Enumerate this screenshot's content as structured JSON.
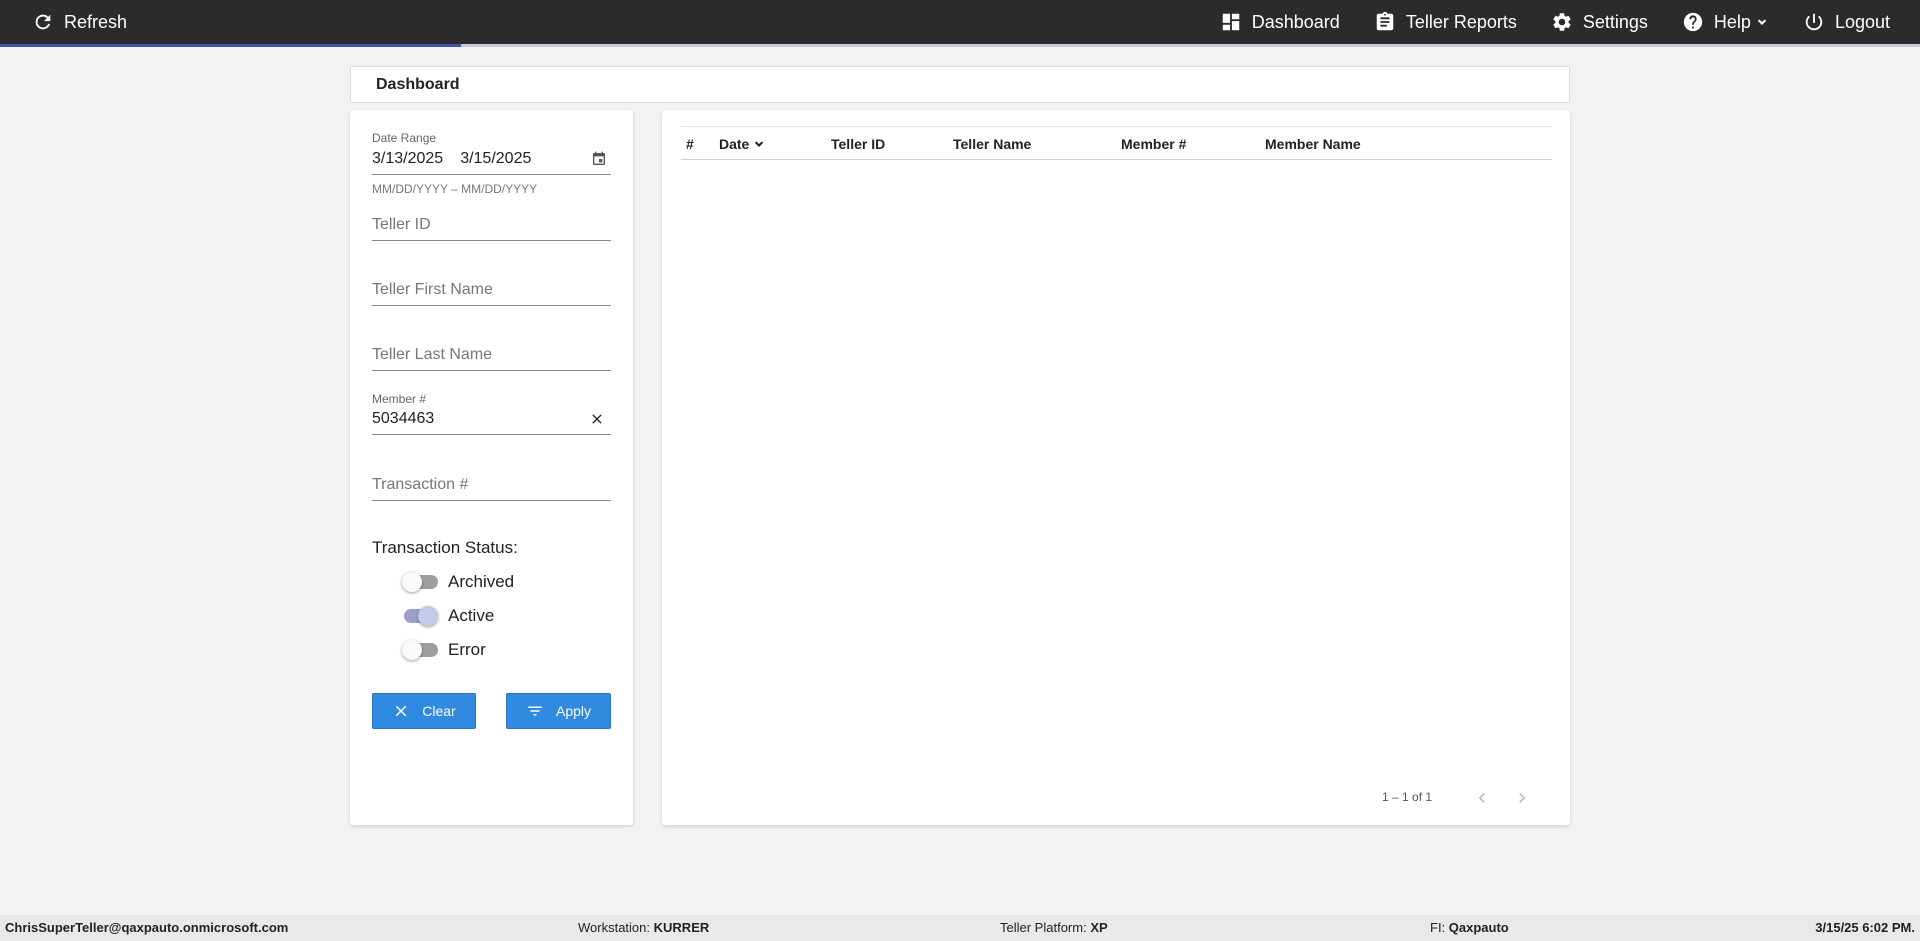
{
  "topbar": {
    "refresh_label": "Refresh",
    "nav": {
      "dashboard": "Dashboard",
      "teller_reports": "Teller Reports",
      "settings": "Settings",
      "help": "Help",
      "logout": "Logout"
    },
    "progress_fraction": 0.24
  },
  "page_title": "Dashboard",
  "filters": {
    "date_range_label": "Date Range",
    "start_date": "3/13/2025",
    "end_date": "3/15/2025",
    "date_hint": "MM/DD/YYYY – MM/DD/YYYY",
    "teller_id_placeholder": "Teller ID",
    "teller_first_name_placeholder": "Teller First Name",
    "teller_last_name_placeholder": "Teller Last Name",
    "member_label": "Member #",
    "member_value": "5034463",
    "transaction_placeholder": "Transaction #",
    "status_label": "Transaction Status:",
    "statuses": [
      {
        "label": "Archived",
        "on": false
      },
      {
        "label": "Active",
        "on": true
      },
      {
        "label": "Error",
        "on": false
      }
    ],
    "clear_label": "Clear",
    "apply_label": "Apply"
  },
  "table": {
    "columns": [
      "#",
      "Date",
      "Teller ID",
      "Teller Name",
      "Member #",
      "Member Name"
    ],
    "rows": [],
    "pagination": "1 – 1 of 1"
  },
  "footer": {
    "user": "ChrisSuperTeller@qaxpauto.onmicrosoft.com",
    "workstation_label": "Workstation:",
    "workstation": "KURRER",
    "platform_label": "Teller Platform:",
    "platform": "XP",
    "fi_label": "FI:",
    "fi": "Qaxpauto",
    "datetime": "3/15/25 6:02 PM."
  },
  "colors": {
    "topbar_bg": "#2b2b2b",
    "progress": "#3f51b5",
    "button_primary": "#2f8ae0",
    "page_bg": "#f2f2f2"
  }
}
